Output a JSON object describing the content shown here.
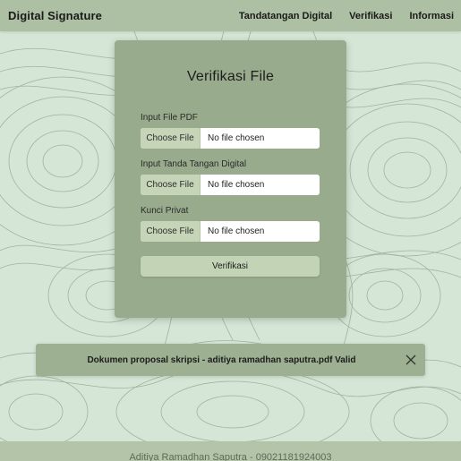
{
  "navbar": {
    "brand": "Digital Signature",
    "links": [
      "Tandatangan Digital",
      "Verifikasi",
      "Informasi"
    ]
  },
  "form": {
    "title": "Verifikasi File",
    "fields": [
      {
        "label": "Input File PDF",
        "button": "Choose File",
        "value": "No file chosen"
      },
      {
        "label": "Input Tanda Tangan Digital",
        "button": "Choose File",
        "value": "No file chosen"
      },
      {
        "label": "Kunci Privat",
        "button": "Choose File",
        "value": "No file chosen"
      }
    ],
    "submit_label": "Verifikasi"
  },
  "alert": {
    "message": "Dokumen proposal skripsi - aditiya ramadhan saputra.pdf Valid",
    "close_icon": "close-icon"
  },
  "footer": {
    "text": "Aditiya Ramadhan Saputra - 09021181924003"
  },
  "colors": {
    "background": "#d5e6d6",
    "contour_lines": "#9fb39f",
    "navbar": "#aec0a3",
    "card": "#99ab8d",
    "button": "#c3d3b6",
    "alert": "#9db091",
    "footer": "#b3c4a8"
  }
}
